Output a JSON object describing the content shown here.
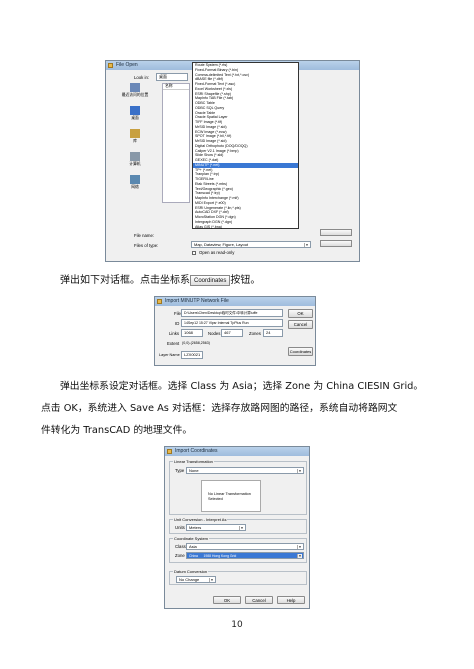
{
  "file_open": {
    "title": "File Open",
    "lookin_label": "Look in:",
    "lookin_value": "桌面",
    "column_name": "名称",
    "sidebar": [
      "最近访问的位置",
      "桌面",
      "库",
      "计算机",
      "网络"
    ],
    "list": [
      "Route System (*.rts)",
      "Fixed-Format Binary (*.bin)",
      "Comma-delimited Text (*.txt,*.csv)",
      "dBASE file (*.dbf)",
      "Fixed-Format Text (*.asc)",
      "Excel Worksheet (*.xls)",
      "ESRI Shapefile (*.shp)",
      "MapInfo TAB File (*.tab)",
      "ODBC Table",
      "ODBC SQL Query",
      "Oracle Table",
      "Oracle Spatial Layer",
      "TIFF Image (*.tif)",
      "MrSID Image (*.sid)",
      "ECW Image (*.ecw)",
      "SPOT Image (*.bil,*.tif)",
      "MrSID Image (*.sid)",
      "Digital Orthophoto (DOQ/DOQQ)",
      "Caliper V2.1 Image (*.bmp)",
      "Slide Show (*.sld)",
      "GEXEC (*.dat)",
      "MINUTP (*.net)",
      "TP+ (*.net)",
      "Tranplan (*.trp)",
      "TIGER/Line",
      "Etak Streets (*.mbs)",
      "Text/Geographic (*.geo)",
      "Transcad (*.trp)",
      "MapInfo Interchange (*.mif)",
      "MIDI Export (*.e00)",
      "ESRI Ungenerate (*.lin,*.pts)",
      "AutoCAD DXF (*.dxf)",
      "MicroStation DGN (*.dgn)",
      "Intergraph DGN (*.dgn)",
      "Atlas GIS (*.bna)"
    ],
    "selected_index": 21,
    "file_name_label": "File name:",
    "file_type_label": "Files of type:",
    "file_type_value": "Map, Dataview, Figure, Layout",
    "read_only_label": "Open as read-only"
  },
  "para1": {
    "before": "弹出如下对话框。点击坐标系",
    "button": "Coordinates",
    "after": "按钮。"
  },
  "minutp": {
    "title": "Import MINUTP Network File",
    "file_label": "File",
    "file_value": "D:\\Users\\Chen\\Desktop\\临时文件\\中转计算\\uffe",
    "id_label": "ID",
    "id_value": "14Sep12 15:27 Vlpsr Internal TpPlus Run",
    "links_label": "Links",
    "links_value": "1068",
    "nodes_label": "Nodes",
    "nodes_value": "467",
    "zones_label": "Zones",
    "zones_value": "24",
    "extent_label": "Extent",
    "extent_value": "(0,0)-(2658,2563)",
    "layer_label": "Layer Name",
    "layer_value": "LZX0021",
    "ok": "OK",
    "cancel": "Cancel",
    "coordinates": "Coordinates"
  },
  "para2": {
    "line1": "弹出坐标系设定对话框。选择 Class 为 Asia；选择 Zone 为 China CIESIN Grid。",
    "line2": "点击 OK，系统进入 Save As 对话框：选择存放路网图的路径，系统自动将路网文",
    "line3": "件转化为 TransCAD 的地理文件。"
  },
  "import_coords": {
    "title": "Import Coordinates",
    "lt_group": "Linear Transformation",
    "type_label": "Type",
    "type_value": "None",
    "no_lt": "No Linear Transformation",
    "selected": "Selected",
    "unit_group": "Unit Conversion - Interpret As",
    "units_label": "Units",
    "units_value": "Meters",
    "cs_group": "Coordinate System",
    "class_label": "Class",
    "class_value": "Asia",
    "zone_label": "Zone",
    "zone_value": "China      1988 Hong Kong Grid",
    "datum_group": "Datum Conversion",
    "datum_value": "No Change",
    "ok": "OK",
    "cancel": "Cancel",
    "help": "Help"
  },
  "page_number": "10"
}
